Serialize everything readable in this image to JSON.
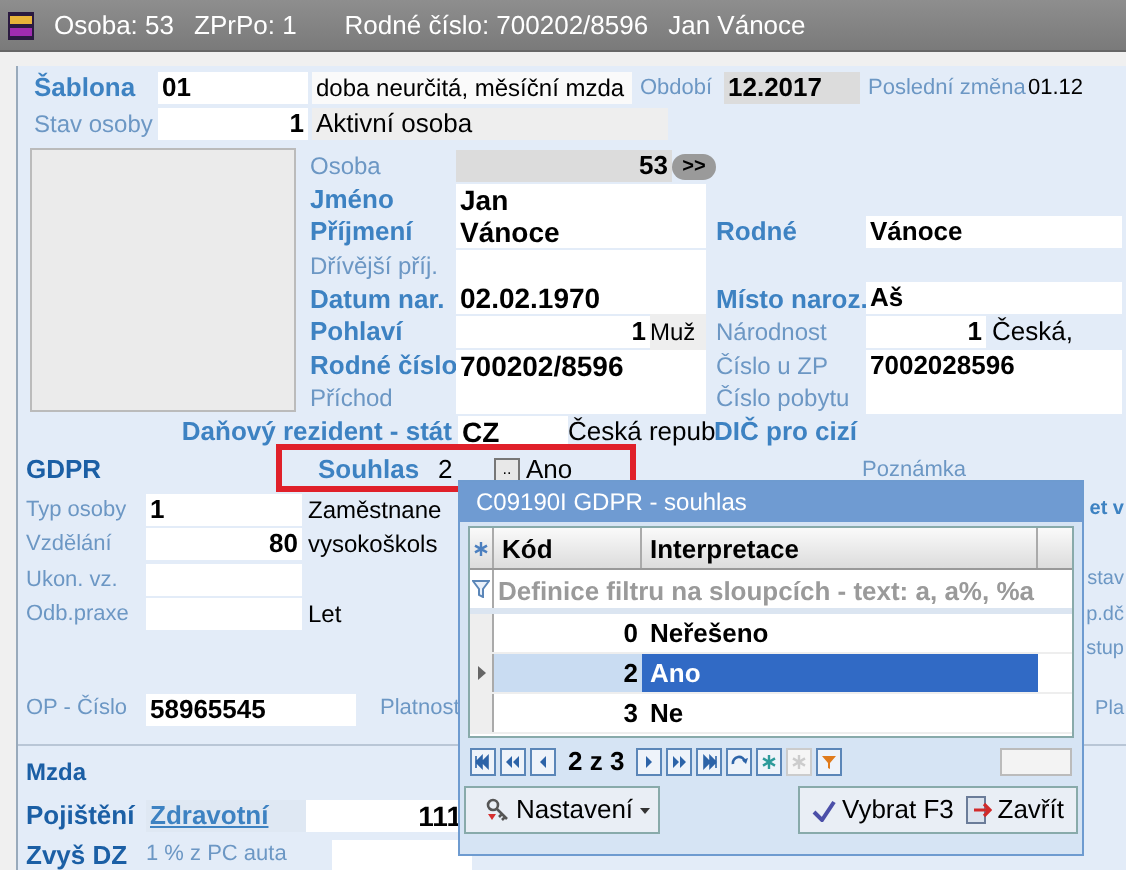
{
  "window": {
    "title_parts": [
      "Osoba: 53",
      "ZPrPo: 1",
      "Rodné číslo: 700202/8596",
      "Jan Vánoce"
    ]
  },
  "template": {
    "rows": [
      {
        "kind": "template",
        "label": "Šablona",
        "value": "01",
        "description": "doba neurčitá, měsíční mzda"
      },
      {
        "kind": "status",
        "label": "Stav osoby",
        "value": "1",
        "description": "Aktivní osoba"
      }
    ],
    "period_label": "Období",
    "period": "12.2017",
    "last_change_label": "Poslední změna",
    "last_change": "01.12"
  },
  "person": {
    "rows": [
      {
        "kind": "number_button",
        "label": "Osoba",
        "emphasized": false,
        "value": "53",
        "button": ">>"
      },
      {
        "kind": "text",
        "label": "Jméno",
        "emphasized": true,
        "value": "Jan"
      },
      {
        "kind": "text",
        "label": "Příjmení",
        "emphasized": true,
        "value": "Vánoce",
        "label2": "Rodné",
        "label2_emphasized": true,
        "value2": "Vánoce"
      },
      {
        "kind": "empty",
        "label": "Dřívější příj.",
        "emphasized": false
      },
      {
        "kind": "text",
        "label": "Datum nar.",
        "emphasized": true,
        "value": "02.02.1970",
        "label2": "Místo naroz.",
        "label2_emphasized": true,
        "value2": "Aš"
      },
      {
        "kind": "code",
        "label": "Pohlaví",
        "emphasized": true,
        "value": "1",
        "value_text": "Muž",
        "label2": "Národnost",
        "label2_emphasized": false,
        "value2": "1",
        "value2_text": "Česká,"
      },
      {
        "kind": "text",
        "label": "Rodné číslo",
        "emphasized": true,
        "value": "700202/8596",
        "label2": "Číslo u ZP",
        "label2_emphasized": false,
        "value2": "7002028596"
      },
      {
        "kind": "empty",
        "label": "Příchod",
        "emphasized": false,
        "label2": "Číslo pobytu",
        "label2_emphasized": false
      }
    ],
    "tax": {
      "label": "Daňový rezident - stát",
      "code": "CZ",
      "country": "Česká repub",
      "dic_label": "DIČ pro cizí"
    }
  },
  "gdpr": {
    "title": "GDPR",
    "consent_label": "Souhlas",
    "consent_code": "2",
    "consent_button": "..",
    "consent_text": "Ano",
    "note_label": "Poznámka"
  },
  "employment": {
    "rows": [
      {
        "kind": "field_left",
        "label": "Typ osoby",
        "value": "1",
        "text": "Zaměstnane",
        "right": "et v"
      },
      {
        "kind": "field_right",
        "label": "Vzdělání",
        "value": "80",
        "text": "vysokoškols"
      },
      {
        "kind": "field_left",
        "label": "Ukon. vz.",
        "right": "stav"
      },
      {
        "kind": "field_left",
        "label": "Odb.praxe",
        "text": "Let",
        "right": "p.dč"
      },
      {
        "kind": "blank",
        "right": "stup"
      },
      {
        "kind": "id",
        "label": "OP - Číslo",
        "value": "58965545",
        "text": "Platnost",
        "right": "Pla"
      }
    ]
  },
  "wage": {
    "title": "Mzda",
    "insurance_label": "Pojištění",
    "insurance_type": "Zdravotní",
    "insurance_code": "111",
    "dz_label": "Zvyš DZ",
    "dz_text": "1 % z PC auta"
  },
  "popup": {
    "title": "C09190I GDPR - souhlas",
    "columns": [
      "Kód",
      "Interpretace"
    ],
    "filter_hint": "Definice filtru na sloupcích - text: a, a%, %a",
    "rows": [
      {
        "code": "0",
        "text": "Neřešeno",
        "selected": false
      },
      {
        "code": "2",
        "text": "Ano",
        "selected": true
      },
      {
        "code": "3",
        "text": "Ne",
        "selected": false
      }
    ],
    "position": "2 z 3",
    "settings": "Nastavení",
    "select": "Vybrat F3",
    "close": "Zavřít"
  }
}
